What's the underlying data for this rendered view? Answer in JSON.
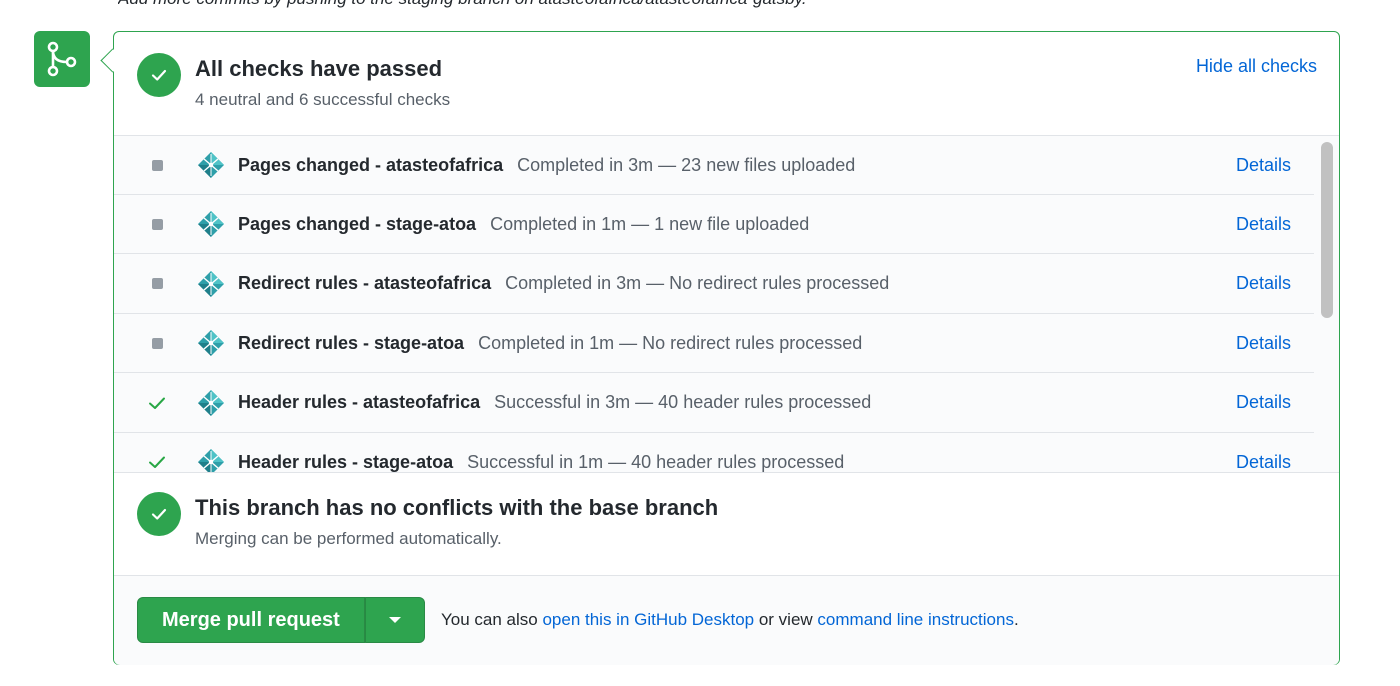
{
  "top_cutoff_text": "Add more commits by pushing to the staging branch on atasteofafrica/atasteofafrica-gatsby.",
  "colors": {
    "success": "#2ea44f",
    "link": "#0366d6",
    "muted": "#586069",
    "neutral": "#959da5"
  },
  "checks_summary": {
    "title": "All checks have passed",
    "subtitle": "4 neutral and 6 successful checks",
    "hide_label": "Hide all checks"
  },
  "checks": [
    {
      "state": "neutral",
      "icon": "netlify-icon",
      "name": "Pages changed - atasteofafrica",
      "desc": "Completed in 3m — 23 new files uploaded",
      "link": "Details"
    },
    {
      "state": "neutral",
      "icon": "netlify-icon",
      "name": "Pages changed - stage-atoa",
      "desc": "Completed in 1m — 1 new file uploaded",
      "link": "Details"
    },
    {
      "state": "neutral",
      "icon": "netlify-icon",
      "name": "Redirect rules - atasteofafrica",
      "desc": "Completed in 3m — No redirect rules processed",
      "link": "Details"
    },
    {
      "state": "neutral",
      "icon": "netlify-icon",
      "name": "Redirect rules - stage-atoa",
      "desc": "Completed in 1m — No redirect rules processed",
      "link": "Details"
    },
    {
      "state": "success",
      "icon": "netlify-icon",
      "name": "Header rules - atasteofafrica",
      "desc": "Successful in 3m — 40 header rules processed",
      "link": "Details"
    },
    {
      "state": "success",
      "icon": "netlify-icon",
      "name": "Header rules - stage-atoa",
      "desc": "Successful in 1m — 40 header rules processed",
      "link": "Details"
    }
  ],
  "conflicts": {
    "title": "This branch has no conflicts with the base branch",
    "subtitle": "Merging can be performed automatically."
  },
  "merge": {
    "button_label": "Merge pull request",
    "text_before": "You can also ",
    "desktop_link": "open this in GitHub Desktop",
    "text_middle": " or view ",
    "cli_link": "command line instructions",
    "text_after": "."
  }
}
